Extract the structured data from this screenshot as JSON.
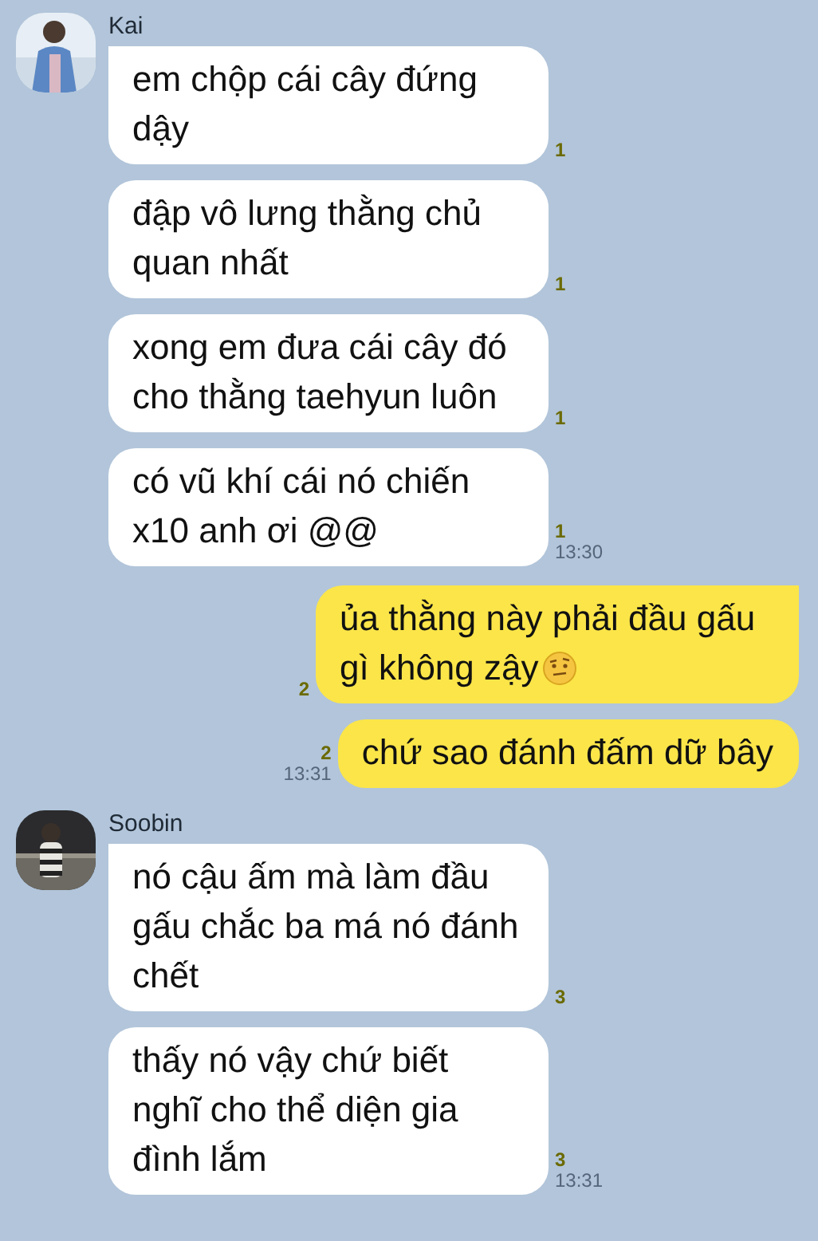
{
  "groups": [
    {
      "kind": "incoming",
      "sender": "Kai",
      "avatar": {
        "kind": "picture"
      },
      "messages": [
        {
          "text": "em chộp cái cây đứng dậy",
          "read": "1"
        },
        {
          "text": "đập vô lưng thằng chủ quan nhất",
          "read": "1"
        },
        {
          "text": "xong em đưa cái cây đó cho thằng taehyun luôn",
          "read": "1"
        },
        {
          "text": "có vũ khí cái nó chiến x10 anh ơi @@",
          "read": "1",
          "time": "13:30"
        }
      ]
    },
    {
      "kind": "outgoing",
      "messages": [
        {
          "text": "ủa thằng này phải đầu gấu gì không zậy",
          "read": "2",
          "emoji": true
        },
        {
          "text": "chứ sao đánh đấm dữ bây",
          "read": "2",
          "time": "13:31"
        }
      ]
    },
    {
      "kind": "incoming",
      "sender": "Soobin",
      "avatar": {
        "kind": "picture"
      },
      "messages": [
        {
          "text": "nó cậu ấm mà làm đầu gấu chắc ba má nó đánh chết",
          "read": "3"
        },
        {
          "text": "thấy nó vậy chứ biết nghĩ cho thể diện gia đình lắm",
          "read": "3",
          "time": "13:31"
        }
      ]
    }
  ]
}
